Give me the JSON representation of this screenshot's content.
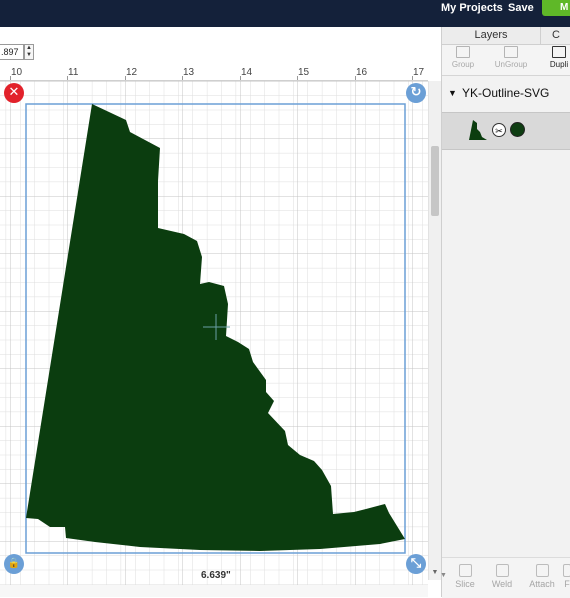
{
  "topbar": {
    "my_projects": "My Projects",
    "save": "Save",
    "make_label": "M"
  },
  "canvas": {
    "size_value": ".897",
    "ruler_labels": [
      "10",
      "11",
      "12",
      "13",
      "14",
      "15",
      "16",
      "17"
    ],
    "width_dimension": "6.639\"",
    "shape_fill": "#0b3d0f",
    "bbox_color": "#6b9fd6",
    "handles": {
      "delete": "✕",
      "rotate": "↻",
      "lock": "🔒",
      "resize": "⤡"
    }
  },
  "panel": {
    "tabs": [
      "Layers",
      "C"
    ],
    "toolbar": [
      "Group",
      "UnGroup",
      "Dupli"
    ],
    "layer_name": "YK-Outline-SVG",
    "layer_color": "#0e3d12",
    "bottom_tools": [
      "Slice",
      "Weld",
      "Attach",
      "F"
    ]
  }
}
